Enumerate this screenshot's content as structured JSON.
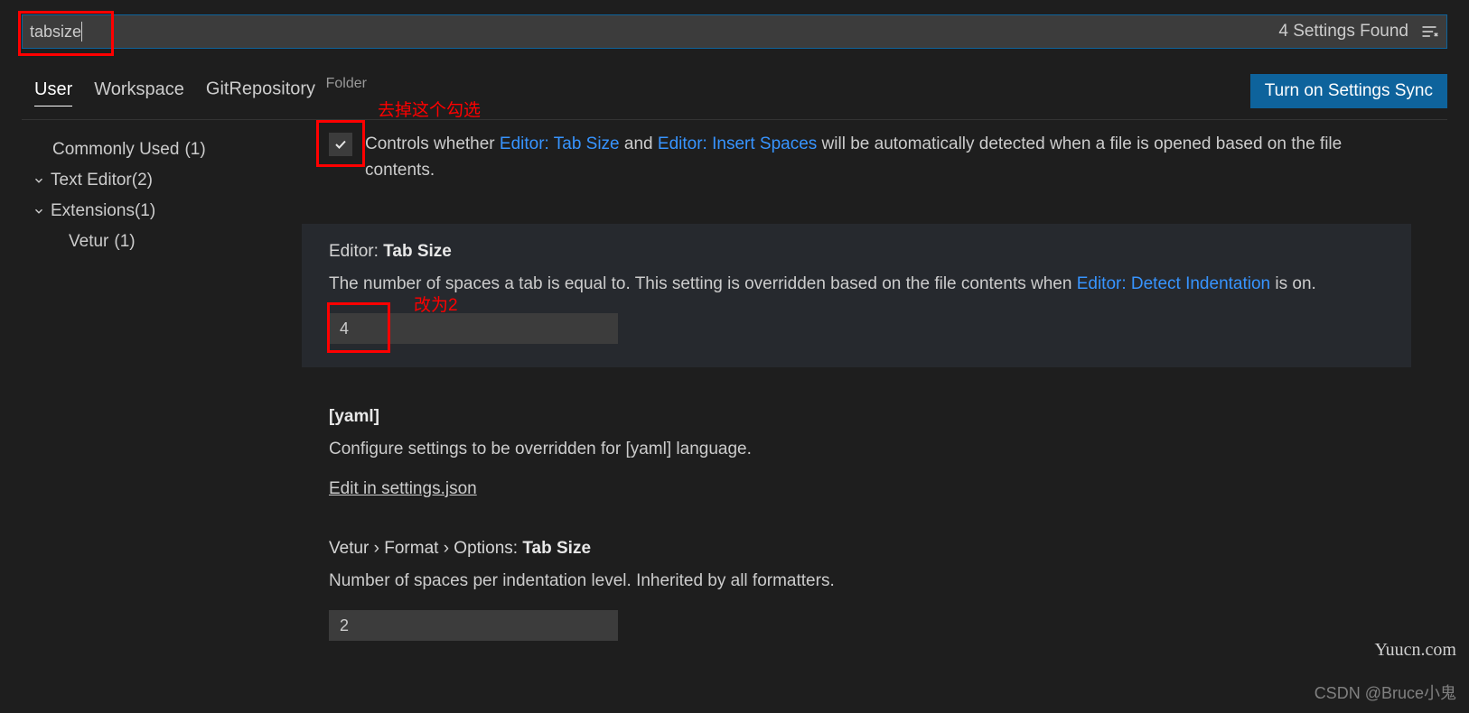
{
  "search": {
    "value": "tabsize",
    "found": "4 Settings Found"
  },
  "tabs": {
    "user": "User",
    "workspace": "Workspace",
    "folder": "GitRepository",
    "folder_tag": "Folder"
  },
  "sync_button": "Turn on Settings Sync",
  "sidebar": {
    "commonly_used": {
      "label": "Commonly Used",
      "count": "(1)"
    },
    "text_editor": {
      "label": "Text Editor",
      "count": "(2)"
    },
    "extensions": {
      "label": "Extensions",
      "count": "(1)"
    },
    "vetur": {
      "label": "Vetur",
      "count": "(1)"
    }
  },
  "settings": {
    "detect": {
      "desc_pre": "Controls whether ",
      "link1": "Editor: Tab Size",
      "desc_mid": " and ",
      "link2": "Editor: Insert Spaces",
      "desc_post": " will be automatically detected when a file is opened based on the file contents."
    },
    "tabsize": {
      "cat": "Editor: ",
      "name": "Tab Size",
      "desc_pre": "The number of spaces a tab is equal to. This setting is overridden based on the file contents when ",
      "link": "Editor: Detect Indentation",
      "desc_post": " is on.",
      "value": "4"
    },
    "yaml": {
      "title": "[yaml]",
      "desc": "Configure settings to be overridden for [yaml] language.",
      "edit": "Edit in settings.json"
    },
    "vetur": {
      "cat": "Vetur › Format › Options: ",
      "name": "Tab Size",
      "desc": "Number of spaces per indentation level. Inherited by all formatters.",
      "value": "2"
    }
  },
  "annotations": {
    "uncheck": "去掉这个勾选",
    "change": "改为2"
  },
  "watermarks": {
    "w1": "Yuucn.com",
    "w2": "CSDN @Bruce小鬼"
  }
}
